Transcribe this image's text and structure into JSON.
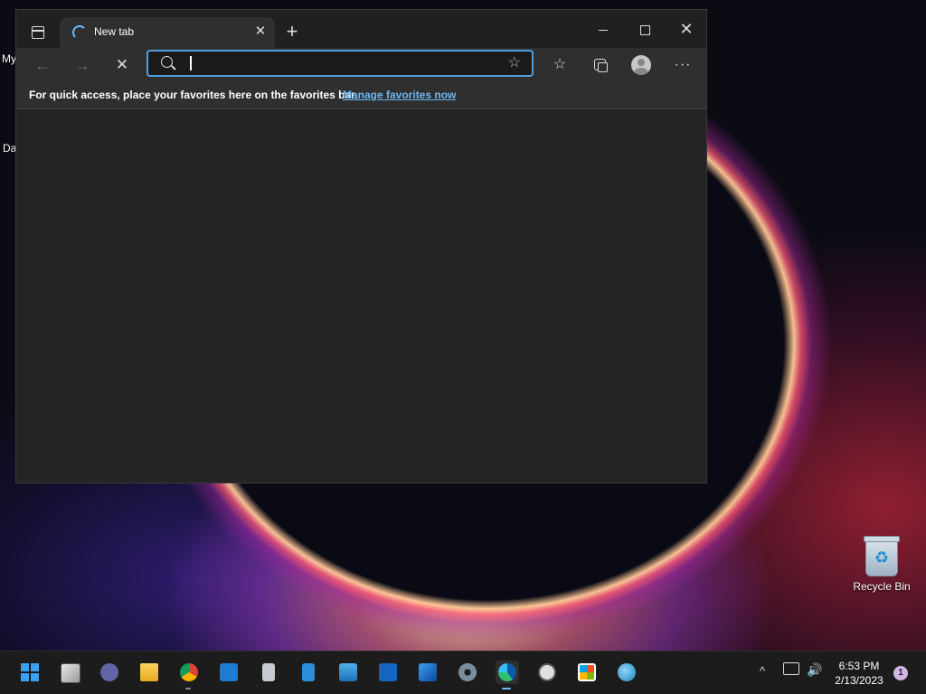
{
  "desktop": {
    "labels": [
      "My",
      "Da"
    ],
    "recycle_bin": "Recycle Bin"
  },
  "browser": {
    "tab": {
      "title": "New tab",
      "close_glyph": "✕"
    },
    "new_tab_glyph": "+",
    "controls": {
      "minimize": "—",
      "maximize": "",
      "close": "✕"
    },
    "toolbar": {
      "back": "←",
      "forward": "→",
      "stop": "✕",
      "favorites": "☆",
      "more": "···"
    },
    "address": {
      "value": "",
      "placeholder": ""
    },
    "favorites_bar": {
      "message": "For quick access, place your favorites here on the favorites bar.",
      "link": "Manage favorites now"
    }
  },
  "taskbar": {
    "apps": [
      {
        "name": "start-button",
        "icon": "windows-logo-icon"
      },
      {
        "name": "task-view-button",
        "icon": "task-view-icon"
      },
      {
        "name": "teams-chat-button",
        "icon": "teams-icon"
      },
      {
        "name": "file-explorer-button",
        "icon": "folder-icon"
      },
      {
        "name": "chrome-button",
        "icon": "chrome-icon"
      },
      {
        "name": "calendar-button",
        "icon": "calendar-icon"
      },
      {
        "name": "calculator-button",
        "icon": "calculator-icon"
      },
      {
        "name": "notepad-button",
        "icon": "notepad-icon"
      },
      {
        "name": "control-panel-button",
        "icon": "control-panel-icon"
      },
      {
        "name": "media-player-button",
        "icon": "movie-icon"
      },
      {
        "name": "photos-button",
        "icon": "photos-icon"
      },
      {
        "name": "settings-button",
        "icon": "gear-icon"
      },
      {
        "name": "edge-button",
        "icon": "edge-icon"
      },
      {
        "name": "clock-app-button",
        "icon": "clock-icon"
      },
      {
        "name": "store-button",
        "icon": "store-icon"
      },
      {
        "name": "maps-button",
        "icon": "globe-icon"
      }
    ],
    "tray": {
      "chevron": "^",
      "volume": "🔊"
    },
    "clock": {
      "time": "6:53 PM",
      "date": "2/13/2023"
    },
    "notification_count": "1"
  },
  "colors": {
    "accent": "#4f9fe3",
    "link": "#6cb8f6",
    "window_bg": "#202020",
    "toolbar_bg": "#2f2f2f"
  }
}
